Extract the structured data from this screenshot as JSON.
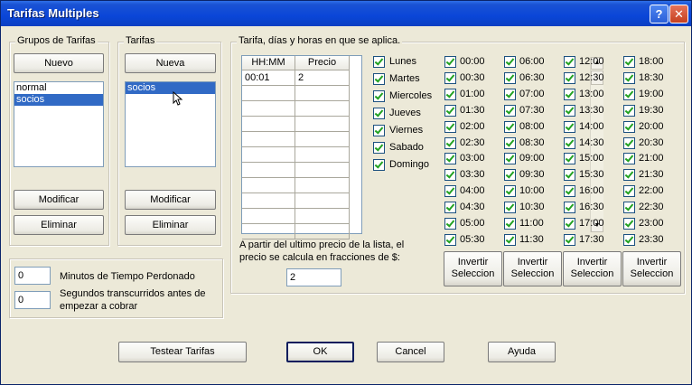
{
  "window": {
    "title": "Tarifas Multiples",
    "help_glyph": "?",
    "close_glyph": "✕"
  },
  "grupos": {
    "legend": "Grupos de Tarifas",
    "new_label": "Nuevo",
    "items": [
      {
        "label": "normal",
        "selected": false
      },
      {
        "label": "socios",
        "selected": true
      }
    ],
    "modify_label": "Modificar",
    "delete_label": "Eliminar"
  },
  "tarifas": {
    "legend": "Tarifas",
    "new_label": "Nueva",
    "items": [
      {
        "label": "socios",
        "selected": true
      }
    ],
    "modify_label": "Modificar",
    "delete_label": "Eliminar"
  },
  "schedule": {
    "legend": "Tarifa, días y horas en que se aplica.",
    "grid": {
      "headers": [
        "HH:MM",
        "Precio"
      ],
      "rows": [
        [
          "00:01",
          "2"
        ],
        [
          "",
          ""
        ],
        [
          "",
          ""
        ],
        [
          "",
          ""
        ],
        [
          "",
          ""
        ],
        [
          "",
          ""
        ],
        [
          "",
          ""
        ],
        [
          "",
          ""
        ],
        [
          "",
          ""
        ],
        [
          "",
          ""
        ],
        [
          "",
          ""
        ]
      ]
    },
    "days": [
      "Lunes",
      "Martes",
      "Miercoles",
      "Jueves",
      "Viernes",
      "Sabado",
      "Domingo"
    ],
    "times": [
      [
        "00:00",
        "00:30",
        "01:00",
        "01:30",
        "02:00",
        "02:30",
        "03:00",
        "03:30",
        "04:00",
        "04:30",
        "05:00",
        "05:30"
      ],
      [
        "06:00",
        "06:30",
        "07:00",
        "07:30",
        "08:00",
        "08:30",
        "09:00",
        "09:30",
        "10:00",
        "10:30",
        "11:00",
        "11:30"
      ],
      [
        "12:00",
        "12:30",
        "13:00",
        "13:30",
        "14:00",
        "14:30",
        "15:00",
        "15:30",
        "16:00",
        "16:30",
        "17:00",
        "17:30"
      ],
      [
        "18:00",
        "18:30",
        "19:00",
        "19:30",
        "20:00",
        "20:30",
        "21:00",
        "21:30",
        "22:00",
        "22:30",
        "23:00",
        "23:30"
      ]
    ],
    "invert_label": [
      "Invertir",
      "Seleccion"
    ],
    "fraction_text": [
      "A partir del ultimo precio de la lista, el",
      "precio se calcula en fracciones de $:"
    ],
    "fraction_value": "2"
  },
  "tiempo": {
    "perdonado_value": "0",
    "perdonado_label": "Minutos de Tiempo Perdonado",
    "segundos_value": "0",
    "segundos_label": [
      "Segundos transcurridos antes de",
      "empezar a cobrar"
    ]
  },
  "footer": {
    "test_label": "Testear Tarifas",
    "ok_label": "OK",
    "cancel_label": "Cancel",
    "help_label": "Ayuda"
  },
  "colors": {
    "title_bar": "#0a46d8",
    "selection": "#316ac5",
    "check": "#21a121"
  }
}
